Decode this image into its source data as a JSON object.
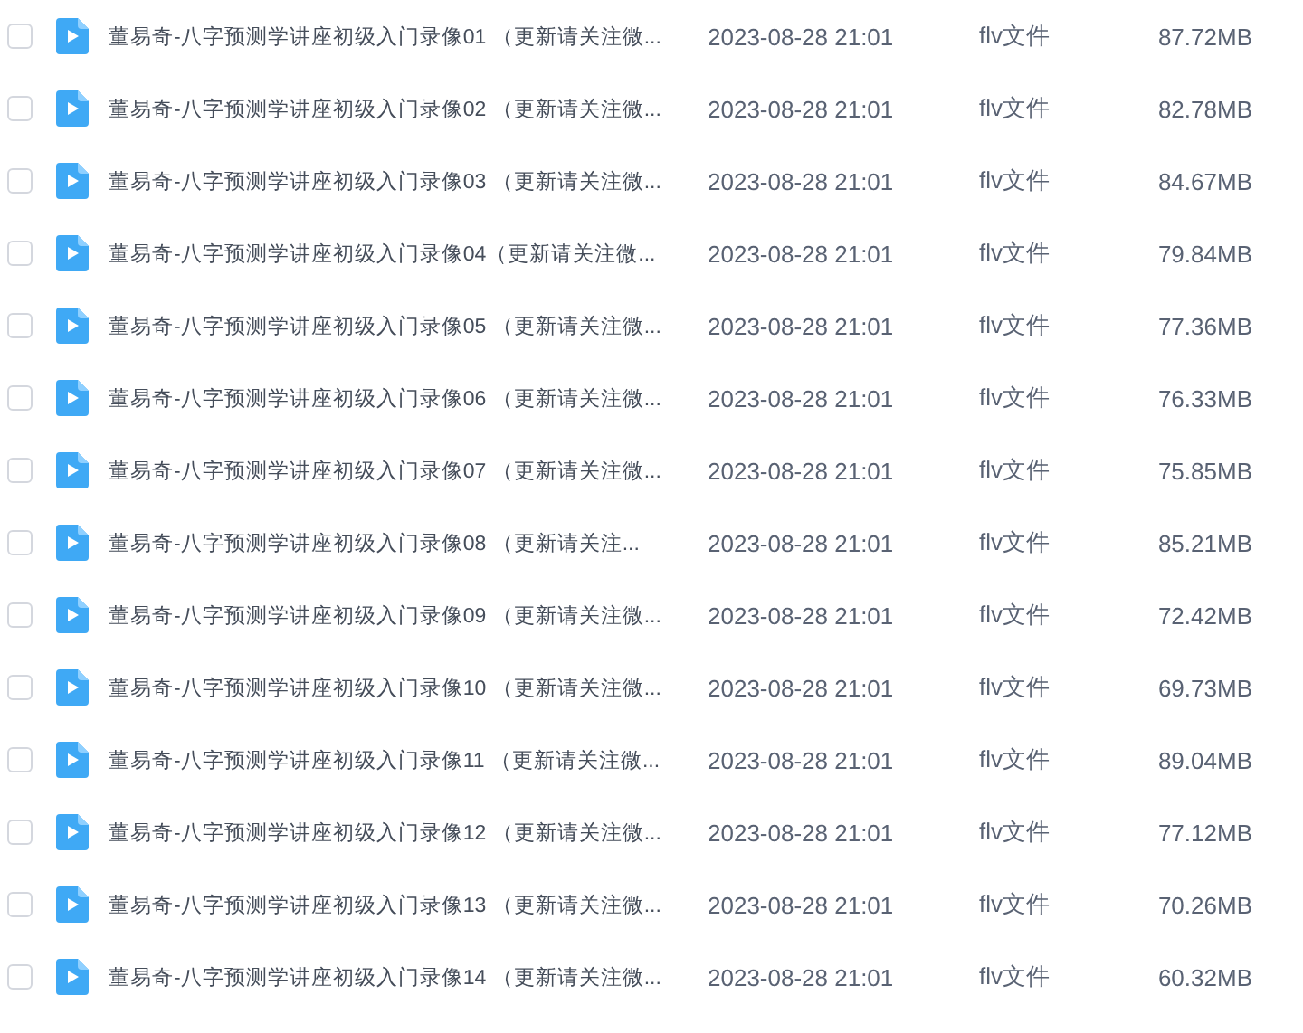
{
  "files": [
    {
      "checked": false,
      "name": "董易奇-八字预测学讲座初级入门录像01  （更新请关注微...",
      "modified": "2023-08-28 21:01",
      "type": "flv文件",
      "size": "87.72MB"
    },
    {
      "checked": false,
      "name": "董易奇-八字预测学讲座初级入门录像02  （更新请关注微...",
      "modified": "2023-08-28 21:01",
      "type": "flv文件",
      "size": "82.78MB"
    },
    {
      "checked": false,
      "name": "董易奇-八字预测学讲座初级入门录像03  （更新请关注微...",
      "modified": "2023-08-28 21:01",
      "type": "flv文件",
      "size": "84.67MB"
    },
    {
      "checked": false,
      "name": "董易奇-八字预测学讲座初级入门录像04（更新请关注微...",
      "modified": "2023-08-28 21:01",
      "type": "flv文件",
      "size": "79.84MB"
    },
    {
      "checked": false,
      "name": "董易奇-八字预测学讲座初级入门录像05 （更新请关注微...",
      "modified": "2023-08-28 21:01",
      "type": "flv文件",
      "size": "77.36MB"
    },
    {
      "checked": false,
      "name": "董易奇-八字预测学讲座初级入门录像06 （更新请关注微...",
      "modified": "2023-08-28 21:01",
      "type": "flv文件",
      "size": "76.33MB"
    },
    {
      "checked": false,
      "name": "董易奇-八字预测学讲座初级入门录像07 （更新请关注微...",
      "modified": "2023-08-28 21:01",
      "type": "flv文件",
      "size": "75.85MB"
    },
    {
      "checked": false,
      "name": "董易奇-八字预测学讲座初级入门录像08   （更新请关注...",
      "modified": "2023-08-28 21:01",
      "type": "flv文件",
      "size": "85.21MB"
    },
    {
      "checked": false,
      "name": "董易奇-八字预测学讲座初级入门录像09  （更新请关注微...",
      "modified": "2023-08-28 21:01",
      "type": "flv文件",
      "size": "72.42MB"
    },
    {
      "checked": false,
      "name": "董易奇-八字预测学讲座初级入门录像10  （更新请关注微...",
      "modified": "2023-08-28 21:01",
      "type": "flv文件",
      "size": "69.73MB"
    },
    {
      "checked": false,
      "name": "董易奇-八字预测学讲座初级入门录像11  （更新请关注微...",
      "modified": "2023-08-28 21:01",
      "type": "flv文件",
      "size": "89.04MB"
    },
    {
      "checked": false,
      "name": "董易奇-八字预测学讲座初级入门录像12  （更新请关注微...",
      "modified": "2023-08-28 21:01",
      "type": "flv文件",
      "size": "77.12MB"
    },
    {
      "checked": false,
      "name": "董易奇-八字预测学讲座初级入门录像13  （更新请关注微...",
      "modified": "2023-08-28 21:01",
      "type": "flv文件",
      "size": "70.26MB"
    },
    {
      "checked": false,
      "name": "董易奇-八字预测学讲座初级入门录像14  （更新请关注微...",
      "modified": "2023-08-28 21:01",
      "type": "flv文件",
      "size": "60.32MB"
    }
  ]
}
